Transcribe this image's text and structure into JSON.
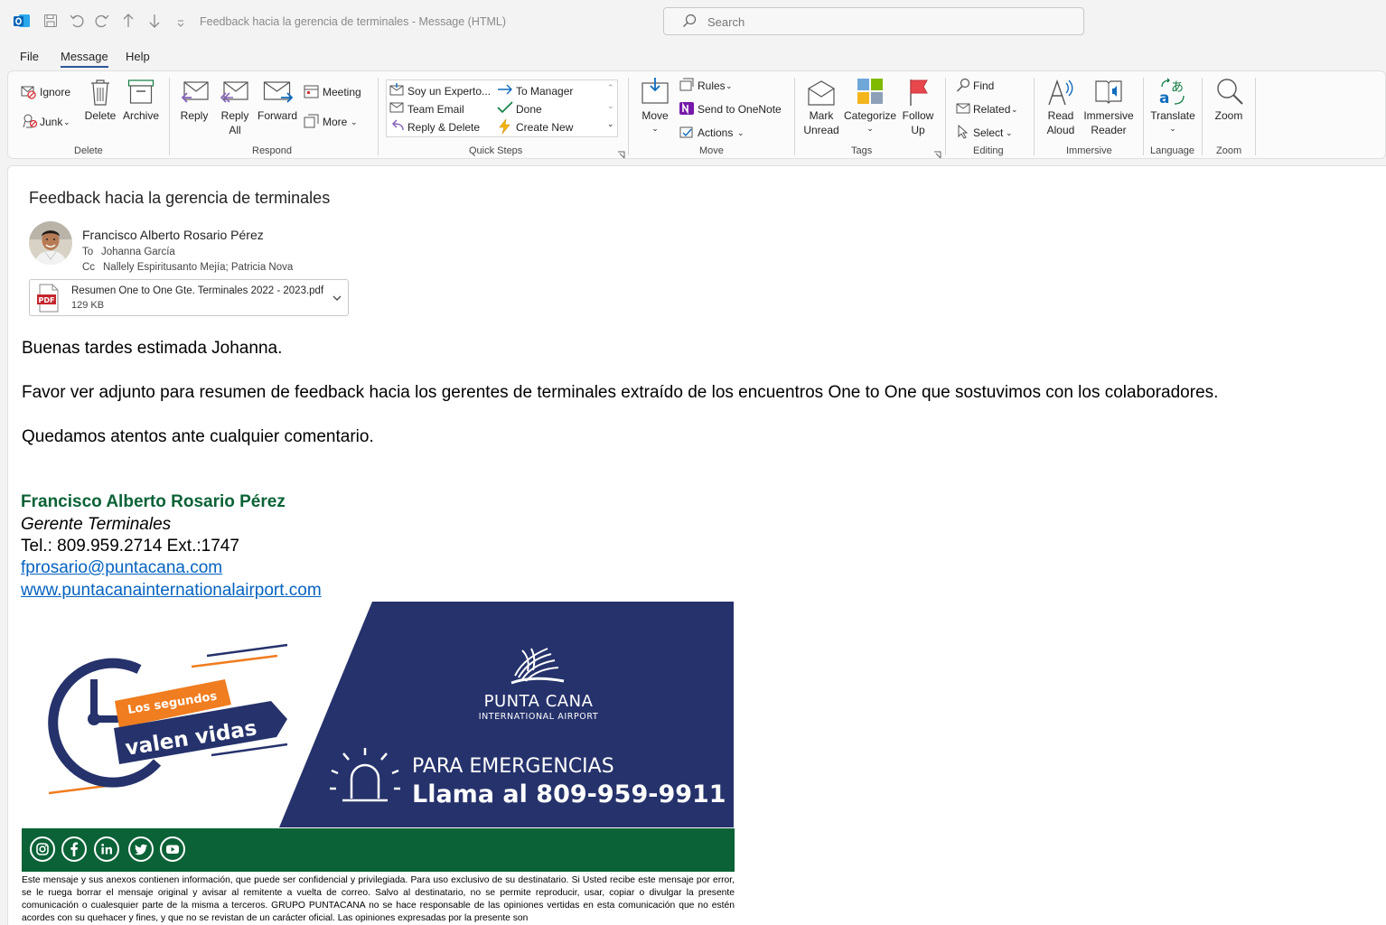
{
  "titlebar": {
    "window_title": "Feedback hacia la gerencia de terminales  -  Message (HTML)",
    "search_placeholder": "Search"
  },
  "menu": {
    "file": "File",
    "message": "Message",
    "help": "Help"
  },
  "ribbon": {
    "delete_group": {
      "ignore": "Ignore",
      "junk": "Junk",
      "delete": "Delete",
      "archive": "Archive",
      "label": "Delete"
    },
    "respond_group": {
      "reply": "Reply",
      "reply_all_1": "Reply",
      "reply_all_2": "All",
      "forward": "Forward",
      "meeting": "Meeting",
      "more": "More",
      "label": "Respond"
    },
    "quick_steps": {
      "items": [
        "Soy un Experto...",
        "Team Email",
        "Reply & Delete",
        "To Manager",
        "Done",
        "Create New"
      ],
      "label": "Quick Steps"
    },
    "move_group": {
      "move": "Move",
      "rules": "Rules",
      "onenote": "Send to OneNote",
      "actions": "Actions",
      "label": "Move"
    },
    "tags_group": {
      "mark_1": "Mark",
      "mark_2": "Unread",
      "categorize": "Categorize",
      "follow_1": "Follow",
      "follow_2": "Up",
      "label": "Tags"
    },
    "editing_group": {
      "find": "Find",
      "related": "Related",
      "select": "Select",
      "label": "Editing"
    },
    "immersive_group": {
      "read_1": "Read",
      "read_2": "Aloud",
      "imm_1": "Immersive",
      "imm_2": "Reader",
      "label": "Immersive"
    },
    "language_group": {
      "translate": "Translate",
      "label": "Language"
    },
    "zoom_group": {
      "zoom": "Zoom",
      "label": "Zoom"
    }
  },
  "message": {
    "subject": "Feedback hacia la gerencia de terminales",
    "sender": "Francisco Alberto Rosario Pérez",
    "to_label": "To",
    "to": "Johanna García",
    "cc_label": "Cc",
    "cc": "Nallely Espiritusanto Mejía; Patricia Nova",
    "attachment": {
      "name": "Resumen One to One  Gte. Terminales 2022 - 2023.pdf",
      "size": "129 KB",
      "type": "PDF"
    },
    "body": [
      "Buenas tardes estimada Johanna.",
      "Favor ver adjunto para resumen de feedback hacia los gerentes de terminales extraído de los encuentros One to One que sostuvimos con los colaboradores.",
      "Quedamos atentos ante cualquier comentario."
    ],
    "signature": {
      "name": "Francisco Alberto Rosario Pérez",
      "title": "Gerente Terminales",
      "phone": "Tel.: 809.959.2714 Ext.:1747",
      "email": "fprosario@puntacana.com",
      "website": "www.puntacanainternationalairport.com"
    },
    "banner": {
      "slogan_1": "Los segundos",
      "slogan_2": "valen vidas",
      "brand_1": "PUNTA CANA",
      "brand_2": "INTERNATIONAL AIRPORT",
      "emergency_1": "PARA EMERGENCIAS",
      "emergency_2": "Llama al 809-959-9911"
    },
    "social_icons": [
      "instagram-icon",
      "facebook-icon",
      "linkedin-icon",
      "twitter-icon",
      "youtube-icon"
    ],
    "disclaimer": "Este mensaje y sus anexos contienen información, que puede ser confidencial y privilegiada. Para uso exclusivo de su destinatario. Si Usted recibe este mensaje por error, se le ruega borrar el mensaje original y avisar al remitente a vuelta de correo. Salvo al destinatario, no se permite reproducir, usar, copiar o divulgar la presente comunicación o cualesquier parte de la misma a terceros. GRUPO PUNTACANA no se hace responsable de las opiniones vertidas en esta comunicación que no estén acordes con su quehacer y fines, y que no se revistan de un carácter oficial. Las opiniones expresadas por la presente son"
  },
  "colors": {
    "accent": "#2b579a",
    "signature_green": "#0a6236",
    "link": "#0563c1",
    "banner_navy": "#25326b",
    "banner_orange": "#f07d1f"
  }
}
